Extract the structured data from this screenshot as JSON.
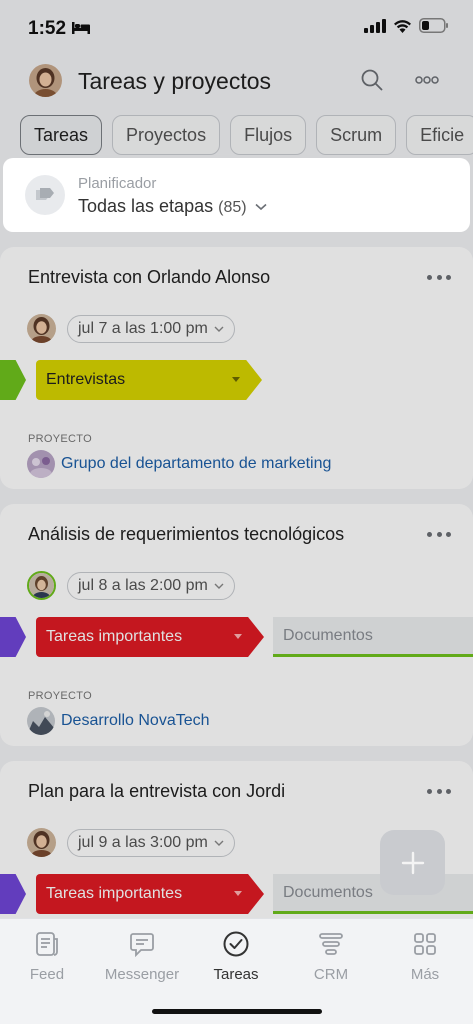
{
  "status_bar": {
    "time": "1:52"
  },
  "header": {
    "title": "Tareas y proyectos"
  },
  "tabs": [
    "Tareas",
    "Proyectos",
    "Flujos",
    "Scrum",
    "Eficie"
  ],
  "planner": {
    "label": "Planificador",
    "value": "Todas las etapas",
    "count": "(85)"
  },
  "tasks": [
    {
      "title": "Entrevista con Orlando Alonso",
      "date": "jul 7 a las 1:00 pm",
      "stage": "Entrevistas",
      "stage_color": "#d8d400",
      "prev_stage_color": "#6fc21d",
      "project_label": "PROYECTO",
      "project": "Grupo del departamento de marketing"
    },
    {
      "title": "Análisis de requerimientos tecnológicos",
      "date": "jul 8 a las 2:00 pm",
      "stage": "Tareas importantes",
      "stage_color": "#e01b24",
      "prev_stage_color": "#7046d8",
      "next_stage": "Documentos",
      "project_label": "PROYECTO",
      "project": "Desarrollo NovaTech"
    },
    {
      "title": "Plan para la entrevista con Jordi",
      "date": "jul 9 a las 3:00 pm",
      "stage": "Tareas importantes",
      "stage_color": "#e01b24",
      "prev_stage_color": "#7046d8",
      "next_stage": "Documentos"
    }
  ],
  "bottom_nav": [
    {
      "label": "Feed",
      "icon": "feed-icon"
    },
    {
      "label": "Messenger",
      "icon": "messenger-icon"
    },
    {
      "label": "Tareas",
      "icon": "tasks-check-icon",
      "active": true
    },
    {
      "label": "CRM",
      "icon": "crm-icon"
    },
    {
      "label": "Más",
      "icon": "more-grid-icon"
    }
  ]
}
